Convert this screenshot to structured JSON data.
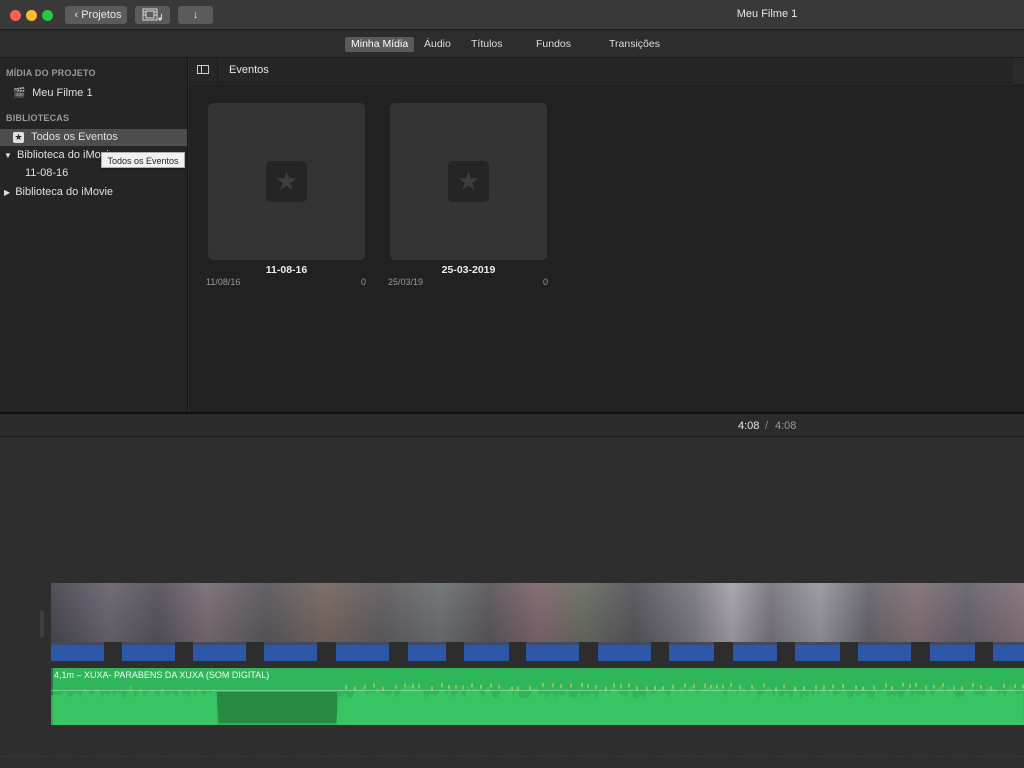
{
  "toolbar": {
    "projects_label": "Projetos",
    "back_icon": "chevron-left-icon",
    "media_icon": "film-music-icon",
    "import_icon": "download-arrow-icon",
    "import_glyph": "↓"
  },
  "window": {
    "title": "Meu Filme 1"
  },
  "browser_tabs": [
    {
      "label": "Minha Mídia",
      "active": true
    },
    {
      "label": "Áudio",
      "active": false
    },
    {
      "label": "Títulos",
      "active": false
    },
    {
      "label": "Fundos",
      "active": false
    },
    {
      "label": "Transições",
      "active": false
    }
  ],
  "sidebar": {
    "project_media_heading": "MÍDIA DO PROJETO",
    "project_item": "Meu Filme 1",
    "libraries_heading": "BIBLIOTECAS",
    "all_events": "Todos os Eventos",
    "library_expanded": "Biblioteca do iMovie",
    "library_event": "11-08-16",
    "library_collapsed": "Biblioteca do iMovie",
    "tooltip": "Todos os Eventos"
  },
  "events_header": {
    "title": "Eventos"
  },
  "events": [
    {
      "name": "11-08-16",
      "date": "11/08/16",
      "count": "0"
    },
    {
      "name": "25-03-2019",
      "date": "25/03/19",
      "count": "0"
    }
  ],
  "timecode": {
    "current": "4:08",
    "separator": "/",
    "total": "4:08"
  },
  "timeline": {
    "audio_clip_label": "4,1m – XUXA- PARABENS DA XUXA (SOM DIGITAL)"
  },
  "colors": {
    "audio_green": "#2fb55a",
    "clip_blue": "#2e58a7",
    "close_red": "#fe5f57",
    "minimize_yellow": "#febc2e",
    "zoom_green": "#28c840"
  }
}
